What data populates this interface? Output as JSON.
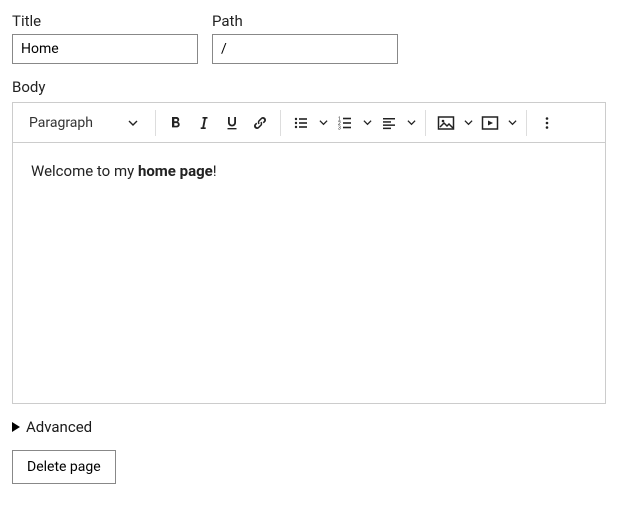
{
  "fields": {
    "title": {
      "label": "Title",
      "value": "Home"
    },
    "path": {
      "label": "Path",
      "value": "/"
    },
    "body": {
      "label": "Body"
    }
  },
  "toolbar": {
    "format_selector": {
      "value": "Paragraph",
      "icon": "chevron-down-icon"
    },
    "buttons": {
      "bold": {
        "icon": "bold-icon"
      },
      "italic": {
        "icon": "italic-icon"
      },
      "underline": {
        "icon": "underline-icon"
      },
      "link": {
        "icon": "link-icon"
      },
      "bulleted_list": {
        "icon": "bulleted-list-icon",
        "has_dropdown": true
      },
      "numbered_list": {
        "icon": "numbered-list-icon",
        "has_dropdown": true
      },
      "alignment": {
        "icon": "align-left-icon",
        "has_dropdown": true
      },
      "image": {
        "icon": "image-icon",
        "has_dropdown": true
      },
      "media": {
        "icon": "media-icon",
        "has_dropdown": true
      },
      "more": {
        "icon": "more-vertical-icon"
      }
    }
  },
  "editor_content": {
    "prefix": "Welcome to my ",
    "bold": "home page",
    "suffix": "!"
  },
  "advanced": {
    "label": "Advanced",
    "expanded": false
  },
  "delete_button": {
    "label": "Delete page"
  }
}
